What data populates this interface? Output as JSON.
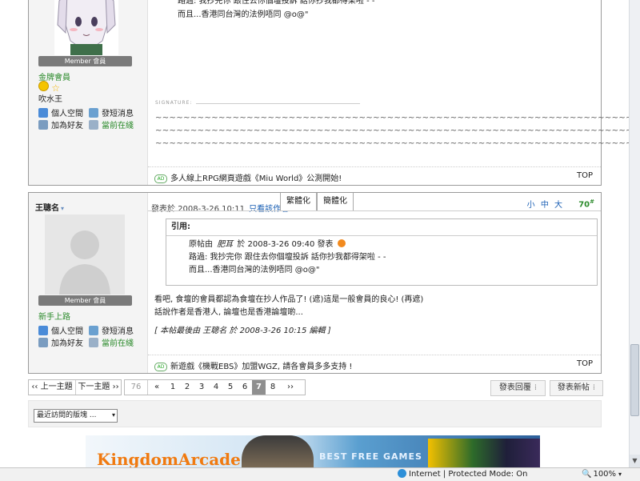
{
  "post1": {
    "msg_line1": "路過: 我抄完你 跟住去你個壇投訴 話你抄我都得架啦 - -",
    "msg_line2": "而且...香港同台灣的法例唔同 @o@\"",
    "member_badge": "Member 會員",
    "rank": "金牌會員",
    "title": "吹水王",
    "actions": {
      "space": "個人空間",
      "message": "發短消息",
      "friend": "加為好友",
      "online": "當前在綫"
    },
    "signature_label": "SIGNATURE:",
    "sig_tilde_1": "~~~~~~~~~~~~~~~~~~~~~~~~~~~~~~~~~~~~~~~~~~~~~~~~~~~~~~~~~~~~~~~~~~~~~~~~~~~~~~~~~~~~~~~~~~~~~~~~~~~~~~~~~~",
    "sig_tilde_2": "~~~~~~~~~~~~~~~~~~~~~~~~~~~~~~~~~~~~~~~~~~~~~~~~~~~~~~~~~~~~~~~~~~~~~~~~~~~~~~~~~~~~~~~~~~~~~~~~~~~~~~~~~~",
    "sig_tilde_3": "~~~~~~~~~~~~~~~~~~~~~~~~~~~~~~~~~~~~~~~~~~~~~~~~~~~~~~~~~~~~~~~~~~~~~~~~~~~~~~~~~~~~~~",
    "ad_text": "多人線上RPG網頁遊戲《Miu World》公測開始!",
    "top": "TOP"
  },
  "post2": {
    "author": "王聰名",
    "posted_prefix": "發表於",
    "posted_time": "2008-3-26 10:11",
    "only_author": "只看該作者",
    "tab_trad": "繁體化",
    "tab_simp": "簡體化",
    "font_small": "小",
    "font_medium": "中",
    "font_large": "大",
    "floor": "70",
    "floor_suffix": "#",
    "quote_title": "引用:",
    "quote_line1_prefix": "原帖由",
    "quote_line1_author": "肥耳",
    "quote_line1_time": "於 2008-3-26 09:40 發表",
    "quote_line2": "路過: 我抄完你 跟住去你個壇投訴 話你抄我都得架啦 - -",
    "quote_line3": "而且...香港同台灣的法例唔同 @o@\"",
    "reply_line1": "看吧, 食壇的會員都認為食壇在抄人作品了! (遮)這是一般會員的良心! (再遮)",
    "reply_line2": "話說作者是香港人, 論壇也是香港論壇啲...",
    "edit_note": "[ 本帖最後由 王聰名 於 2008-3-26 10:15 編輯 ]",
    "member_badge": "Member 會員",
    "rank": "新手上路",
    "actions": {
      "space": "個人空間",
      "message": "發短消息",
      "friend": "加為好友",
      "online": "當前在綫"
    },
    "ad_text": "新遊戲《機戰EBS》加盟WGZ, 請各會員多多支持 !",
    "top": "TOP"
  },
  "pager": {
    "prev_topic": "‹‹ 上一主題",
    "next_topic": "下一主題 ››",
    "total": "76",
    "first": "«",
    "pages": [
      "1",
      "2",
      "3",
      "4",
      "5",
      "6",
      "7",
      "8"
    ],
    "current": "7",
    "next": "››"
  },
  "buttons": {
    "reply": "發表回覆",
    "new_post": "發表新帖"
  },
  "recent_select": "最近訪問的版塊 ...",
  "banner": {
    "brand": "KingdomArcade",
    "slogan": "BEST FREE GAMES"
  },
  "statusbar": {
    "zone": "Internet | Protected Mode: On",
    "zoom": "100%"
  },
  "colors": {
    "link": "#1a5fb4",
    "green_rank": "#2a8a2a",
    "floor": "#2a8a2a"
  }
}
